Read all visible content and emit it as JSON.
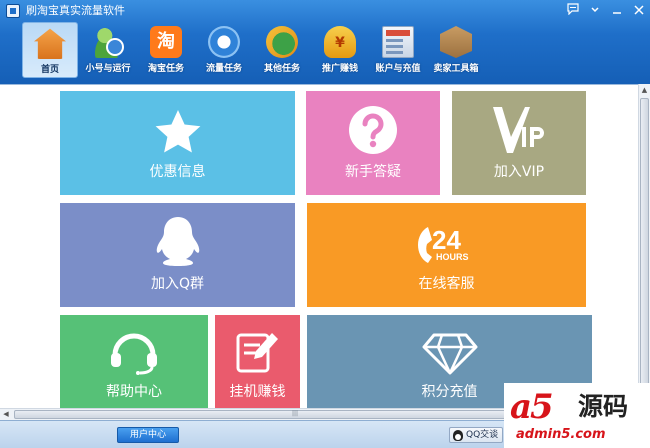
{
  "window": {
    "title": "刷淘宝真实流量软件",
    "controls": [
      "feedback-icon",
      "menu-icon",
      "minimize-icon",
      "close-icon"
    ]
  },
  "nav": {
    "items": [
      {
        "label": "首页",
        "icon": "home-icon",
        "active": true
      },
      {
        "label": "小号与运行",
        "icon": "user-clock-icon"
      },
      {
        "label": "淘宝任务",
        "icon": "taobao-icon",
        "glyph": "淘"
      },
      {
        "label": "流量任务",
        "icon": "refresh-globe-icon"
      },
      {
        "label": "其他任务",
        "icon": "globe-plane-icon"
      },
      {
        "label": "推广赚钱",
        "icon": "money-bag-icon",
        "glyph": "¥"
      },
      {
        "label": "账户与充值",
        "icon": "account-window-icon"
      },
      {
        "label": "卖家工具箱",
        "icon": "toolbox-icon"
      }
    ]
  },
  "tiles": {
    "offer": {
      "label": "优惠信息",
      "icon": "star-icon",
      "color": "#5bc0e6"
    },
    "faq": {
      "label": "新手答疑",
      "icon": "question-icon",
      "color": "#e982c0"
    },
    "vip": {
      "label": "加入VIP",
      "icon": "vip-icon",
      "color": "#a8a882"
    },
    "qq": {
      "label": "加入Q群",
      "icon": "qq-penguin-icon",
      "color": "#7b8ec8"
    },
    "service": {
      "label": "在线客服",
      "icon": "phone-24h-icon",
      "badge_number": "24",
      "badge_text": "HOURS",
      "color": "#f99a25"
    },
    "help": {
      "label": "帮助中心",
      "icon": "headset-icon",
      "color": "#56c177"
    },
    "earn": {
      "label": "挂机赚钱",
      "icon": "pencil-edit-icon",
      "color": "#ea5b6d"
    },
    "points": {
      "label": "积分充值",
      "icon": "diamond-icon",
      "color": "#6a95b3"
    }
  },
  "statusbar": {
    "user_center": "用户中心",
    "qq_chat": "QQ交谈"
  },
  "watermark": {
    "logo": "a5源码",
    "domain": "admin5.com"
  }
}
